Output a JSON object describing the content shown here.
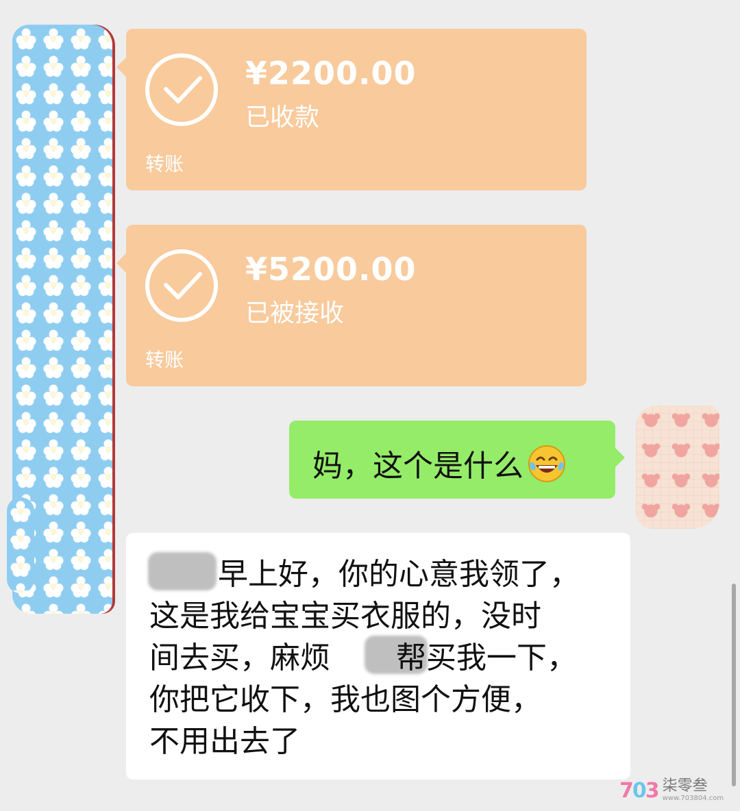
{
  "transfers": [
    {
      "amount": "¥2200.00",
      "status": "已收款",
      "type": "转账",
      "icon": "check-circle-icon"
    },
    {
      "amount": "¥5200.00",
      "status": "已被接收",
      "type": "转账",
      "icon": "check-circle-icon"
    }
  ],
  "my_message": {
    "text": "妈，这个是什么",
    "emoji": "laughing-tears-emoji"
  },
  "their_message": {
    "lines": [
      "早上好，你的心意我领了，",
      "这是我给宝宝买衣服的，没时",
      "间去买，麻烦",
      "帮买我一下，",
      "你把它收下，我也图个方便，",
      "不用出去了"
    ]
  },
  "watermark": {
    "logo_a": "7",
    "logo_b": "0",
    "logo_c": "3",
    "name": "柒零叁",
    "url": "www.703804.com"
  },
  "colors": {
    "background": "#ededed",
    "transfer_card": "#f8ca9c",
    "my_bubble": "#95ec69",
    "their_bubble": "#ffffff"
  }
}
